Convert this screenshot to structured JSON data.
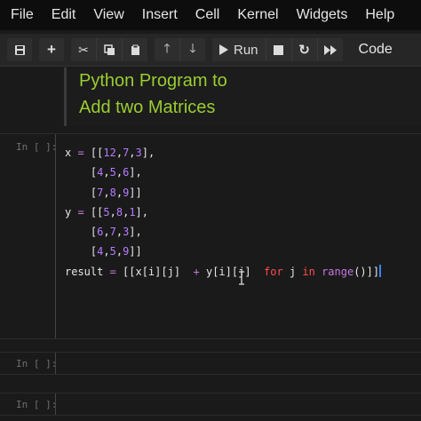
{
  "menu": [
    "File",
    "Edit",
    "View",
    "Insert",
    "Cell",
    "Kernel",
    "Widgets",
    "Help"
  ],
  "toolbar": {
    "run_label": "Run",
    "cell_type": "Code"
  },
  "markdown_cell": {
    "line1": "Python Program to",
    "line2": "Add two Matrices"
  },
  "code_cell": {
    "prompt": "In [ ]:",
    "x_line1": "x = [[12,7,3],",
    "x_line2": "    [4,5,6],",
    "x_line3": "    [7,8,9]]",
    "y_line1": "y = [[5,8,1],",
    "y_line2": "    [6,7,3],",
    "y_line3": "    [4,5,9]]",
    "result_line": "result = [[x[i][j]  + y[i][j]  for j in range()]]"
  },
  "empty_cells": [
    {
      "prompt": "In [ ]:"
    },
    {
      "prompt": "In [ ]:"
    }
  ],
  "colors": {
    "markdown_text": "#9acd32",
    "keyword": "#ff4d4d",
    "function": "#c678dd",
    "number": "#b57cff",
    "cursor": "#3b82f6"
  }
}
